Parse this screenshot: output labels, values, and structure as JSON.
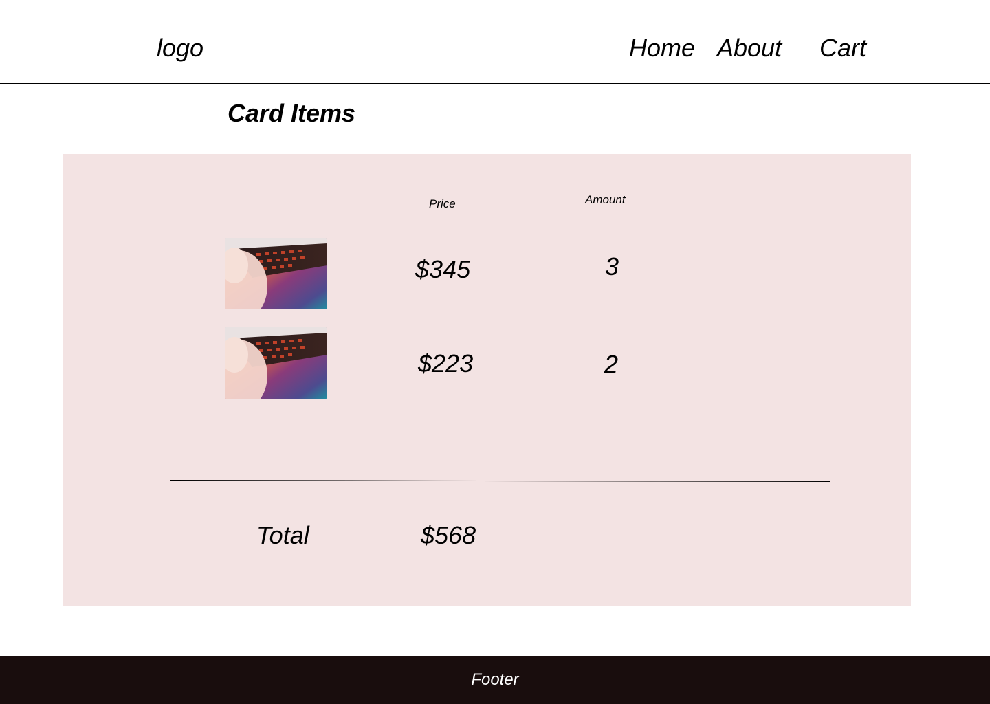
{
  "header": {
    "logo": "logo",
    "nav": {
      "home": "Home",
      "about": "About",
      "cart": "Cart"
    }
  },
  "page_title": "Card Items",
  "cart": {
    "columns": {
      "price": "Price",
      "amount": "Amount"
    },
    "items": [
      {
        "image": "laptop-keyboard-photo",
        "price": "$345",
        "amount": "3"
      },
      {
        "image": "laptop-keyboard-photo",
        "price": "$223",
        "amount": "2"
      }
    ],
    "total_label": "Total",
    "total_value": "$568"
  },
  "footer": {
    "text": "Footer"
  },
  "colors": {
    "panel_background": "#f3e3e3",
    "footer_background": "#190d0d",
    "text": "#000000",
    "footer_text": "#ffffff"
  }
}
